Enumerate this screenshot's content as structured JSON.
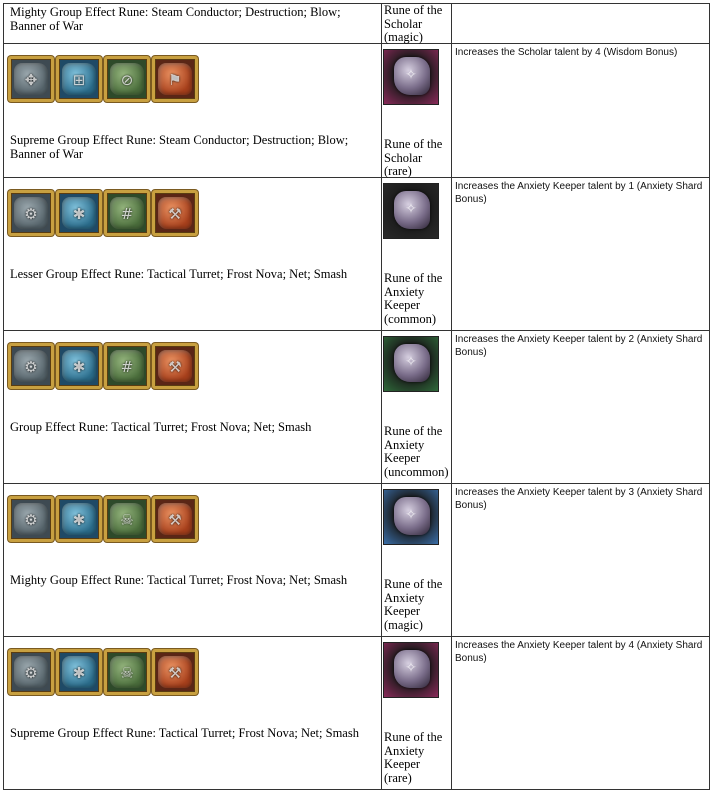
{
  "rows": [
    {
      "effect_name": "Mighty Group Effect Rune: Steam Conductor; Destruction; Blow; Banner of War",
      "rune_name": "Rune of the Scholar (magic)",
      "description": ""
    },
    {
      "rune_icons": [
        {
          "icon": "steam-conductor-rune-icon",
          "color": "#3e4a52",
          "glyph": "✥"
        },
        {
          "icon": "destruction-rune-icon",
          "color": "#1f4a66",
          "glyph": "⊞"
        },
        {
          "icon": "blow-rune-icon",
          "color": "#2e4a2a",
          "glyph": "⊘"
        },
        {
          "icon": "banner-of-war-rune-icon",
          "color": "#5a2616",
          "glyph": "⚑"
        }
      ],
      "rune_image": {
        "icon": "scholar-rune-icon",
        "frame_color": "#8a2a5a"
      },
      "effect_name": "Supreme Group Effect Rune: Steam Conductor; Destruction; Blow; Banner of War",
      "rune_name": "Rune of the Scholar (rare)",
      "description": "Increases the Scholar talent by 4 (Wisdom Bonus)"
    },
    {
      "rune_icons": [
        {
          "icon": "tactical-turret-rune-icon",
          "color": "#3e4a52",
          "glyph": "⚙"
        },
        {
          "icon": "frost-nova-rune-icon",
          "color": "#1f4a66",
          "glyph": "✱"
        },
        {
          "icon": "net-rune-icon",
          "color": "#2e4a2a",
          "glyph": "#"
        },
        {
          "icon": "smash-rune-icon",
          "color": "#5a2616",
          "glyph": "⚒"
        }
      ],
      "rune_image": {
        "icon": "anxiety-keeper-rune-icon",
        "frame_color": "#2a2a2a"
      },
      "effect_name": "Lesser Group Effect Rune: Tactical Turret; Frost Nova; Net; Smash",
      "rune_name": "Rune of the Anxiety Keeper (common)",
      "description": "Increases the Anxiety Keeper talent by 1 (Anxiety Shard Bonus)"
    },
    {
      "rune_icons": [
        {
          "icon": "tactical-turret-rune-icon",
          "color": "#3e4a52",
          "glyph": "⚙"
        },
        {
          "icon": "frost-nova-rune-icon",
          "color": "#1f4a66",
          "glyph": "✱"
        },
        {
          "icon": "net-rune-icon",
          "color": "#2e4a2a",
          "glyph": "#"
        },
        {
          "icon": "smash-rune-icon",
          "color": "#5a2616",
          "glyph": "⚒"
        }
      ],
      "rune_image": {
        "icon": "anxiety-keeper-rune-icon",
        "frame_color": "#2f6a3a"
      },
      "effect_name": "Group Effect Rune: Tactical Turret; Frost Nova; Net; Smash",
      "rune_name": "Rune of the Anxiety Keeper (uncommon)",
      "description": "Increases the Anxiety Keeper talent by 2 (Anxiety Shard Bonus)"
    },
    {
      "rune_icons": [
        {
          "icon": "tactical-turret-rune-icon",
          "color": "#3e4a52",
          "glyph": "⚙"
        },
        {
          "icon": "frost-nova-rune-icon",
          "color": "#1f4a66",
          "glyph": "✱"
        },
        {
          "icon": "net-rune-icon",
          "color": "#2e4a2a",
          "glyph": "☠"
        },
        {
          "icon": "smash-rune-icon",
          "color": "#5a2616",
          "glyph": "⚒"
        }
      ],
      "rune_image": {
        "icon": "anxiety-keeper-rune-icon",
        "frame_color": "#3a6ea8"
      },
      "effect_name": "Mighty Goup Effect Rune: Tactical Turret; Frost Nova; Net; Smash",
      "rune_name": "Rune of the Anxiety Keeper (magic)",
      "description": "Increases the Anxiety Keeper talent by 3 (Anxiety Shard Bonus)"
    },
    {
      "rune_icons": [
        {
          "icon": "tactical-turret-rune-icon",
          "color": "#3e4a52",
          "glyph": "⚙"
        },
        {
          "icon": "frost-nova-rune-icon",
          "color": "#1f4a66",
          "glyph": "✱"
        },
        {
          "icon": "net-rune-icon",
          "color": "#2e4a2a",
          "glyph": "☠"
        },
        {
          "icon": "smash-rune-icon",
          "color": "#5a2616",
          "glyph": "⚒"
        }
      ],
      "rune_image": {
        "icon": "anxiety-keeper-rune-icon",
        "frame_color": "#8a2a5a"
      },
      "effect_name": "Supreme Group Effect Rune: Tactical Turret; Frost Nova; Net; Smash",
      "rune_name": "Rune of the Anxiety Keeper (rare)",
      "description": "Increases the Anxiety Keeper talent by 4 (Anxiety Shard Bonus)"
    }
  ]
}
